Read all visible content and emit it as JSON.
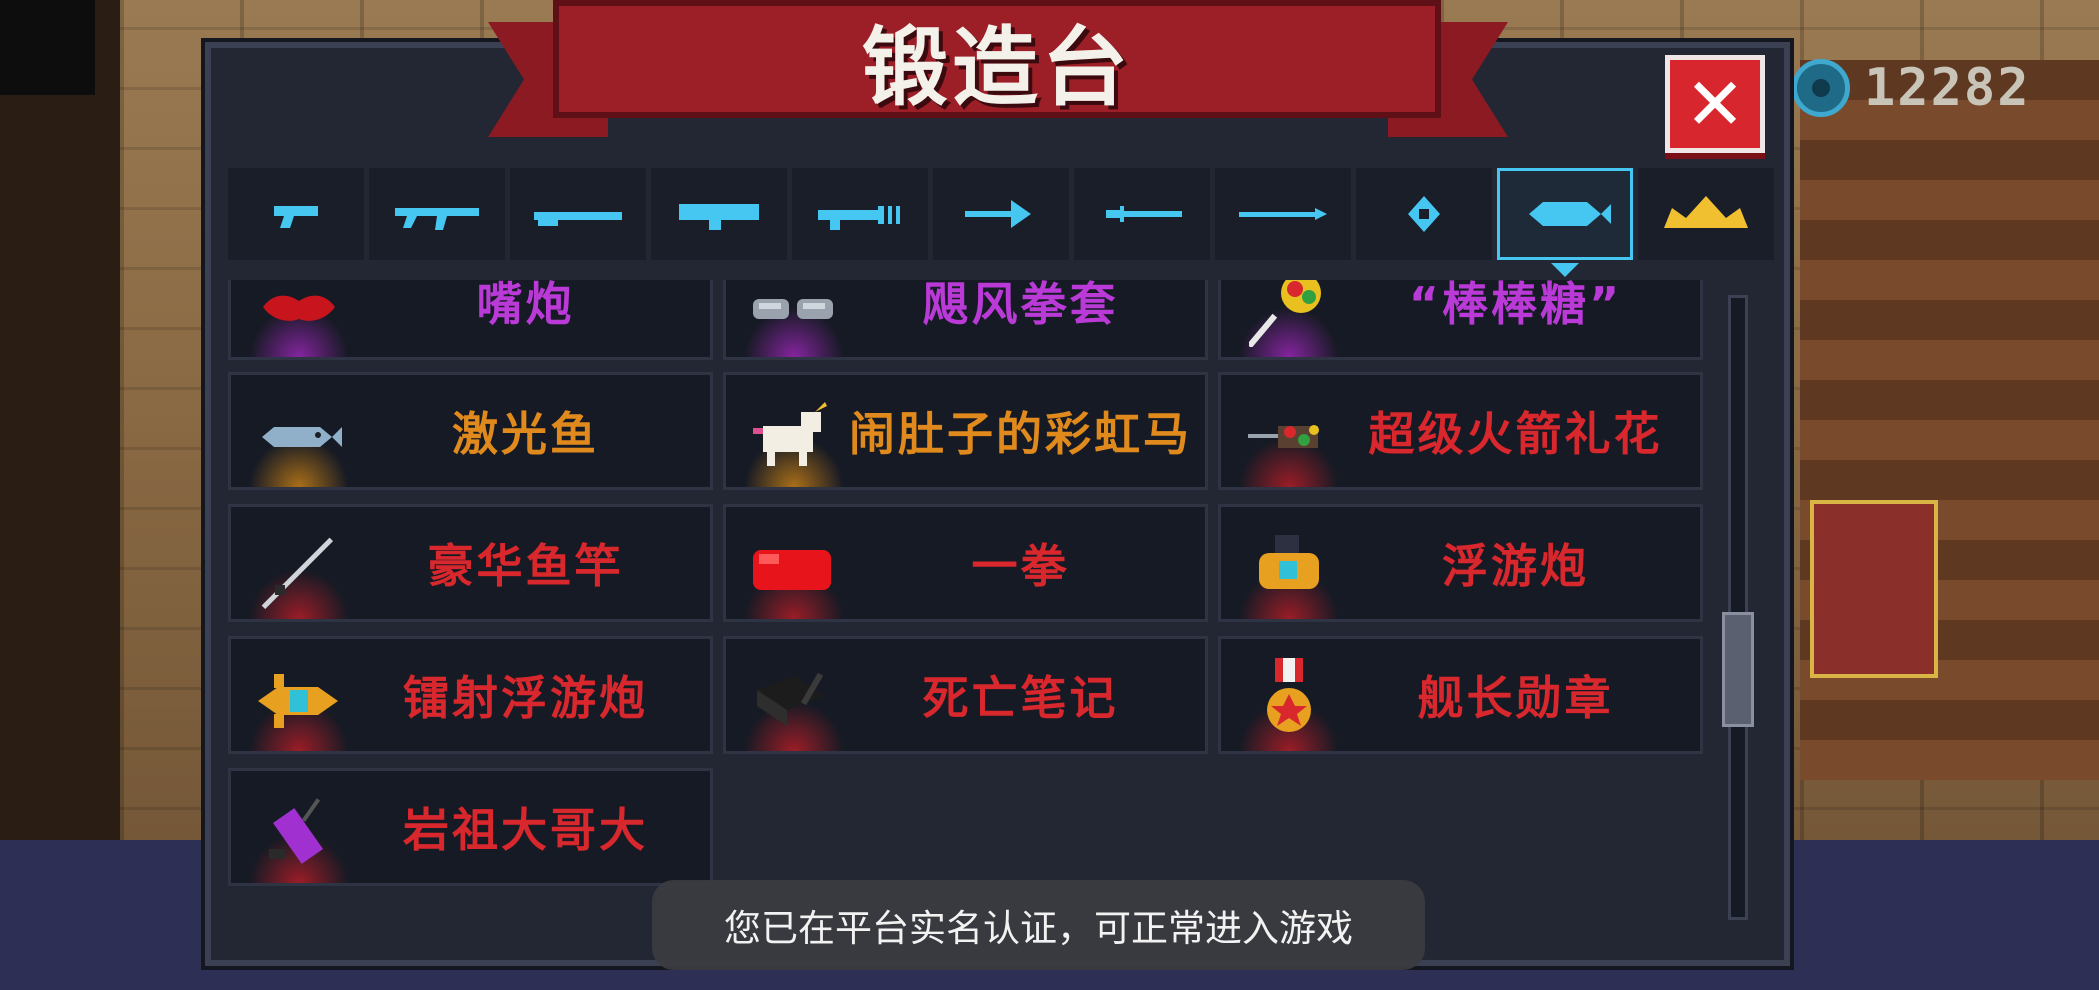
{
  "title": "锻造台",
  "close_label": "✕",
  "coins": {
    "value": "12282",
    "icon": "gem-coin-icon"
  },
  "tabs": [
    {
      "name": "pistol",
      "icon": "pistol-icon",
      "active": false
    },
    {
      "name": "rifle",
      "icon": "rifle-icon",
      "active": false
    },
    {
      "name": "shotgun",
      "icon": "shotgun-icon",
      "active": false
    },
    {
      "name": "launcher",
      "icon": "launcher-icon",
      "active": false
    },
    {
      "name": "laser",
      "icon": "laser-gun-icon",
      "active": false
    },
    {
      "name": "bow",
      "icon": "bow-arrow-icon",
      "active": false
    },
    {
      "name": "sword",
      "icon": "sword-icon",
      "active": false
    },
    {
      "name": "spear",
      "icon": "spear-icon",
      "active": false
    },
    {
      "name": "throwing",
      "icon": "shuriken-icon",
      "active": false
    },
    {
      "name": "special",
      "icon": "fish-icon",
      "active": true
    },
    {
      "name": "crown",
      "icon": "crown-icon",
      "active": false
    }
  ],
  "items": [
    [
      {
        "name": "嘴炮",
        "rarity": "purple",
        "icon": "lips-icon"
      },
      {
        "name": "飓风拳套",
        "rarity": "purple",
        "icon": "gauntlet-icon"
      },
      {
        "name": "“棒棒糖”",
        "rarity": "purple",
        "icon": "lollipop-icon"
      }
    ],
    [
      {
        "name": "激光鱼",
        "rarity": "orange",
        "icon": "fish-icon"
      },
      {
        "name": "闹肚子的彩虹马",
        "rarity": "orange",
        "icon": "unicorn-icon"
      },
      {
        "name": "超级火箭礼花",
        "rarity": "red",
        "icon": "rocket-firework-icon"
      }
    ],
    [
      {
        "name": "豪华鱼竿",
        "rarity": "red",
        "icon": "fishing-rod-icon"
      },
      {
        "name": "一拳",
        "rarity": "red",
        "icon": "boxing-glove-icon"
      },
      {
        "name": "浮游炮",
        "rarity": "red",
        "icon": "drone-icon"
      }
    ],
    [
      {
        "name": "镭射浮游炮",
        "rarity": "red",
        "icon": "laser-drone-icon"
      },
      {
        "name": "死亡笔记",
        "rarity": "red",
        "icon": "notebook-icon"
      },
      {
        "name": "舰长勋章",
        "rarity": "red",
        "icon": "medal-icon"
      }
    ],
    [
      {
        "name": "岩祖大哥大",
        "rarity": "red",
        "icon": "cellphone-icon"
      }
    ]
  ],
  "toast": "您已在平台实名认证，可正常进入游戏",
  "colors": {
    "purple": "#b93ad6",
    "orange": "#e08a1e",
    "red": "#d8272d",
    "accent": "#45c7f2"
  }
}
